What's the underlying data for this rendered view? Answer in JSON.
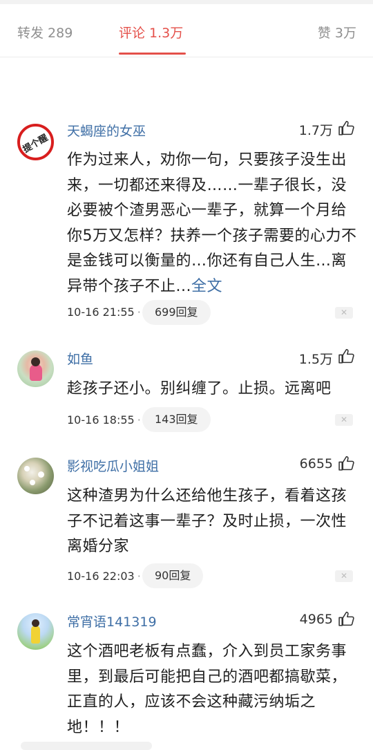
{
  "tabs": [
    {
      "label": "转发 289"
    },
    {
      "label": "评论 1.3万"
    },
    {
      "label": "赞 3万"
    }
  ],
  "comments": [
    {
      "name": "天蝎座的女巫",
      "likes": "1.7万",
      "avatar_text": "提个醒",
      "text": "作为过来人，劝你一句，只要孩子没生出来，一切都还来得及……一辈子很长，没必要被个渣男恶心一辈子，就算一个月给你5万又怎样？扶养一个孩子需要的心力不是金钱可以衡量的…你还有自己人生…离异带个孩子不止...",
      "more": "全文",
      "time": "10-16 21:55",
      "replies": "699回复"
    },
    {
      "name": "如鱼",
      "likes": "1.5万",
      "text": "趁孩子还小。别纠缠了。止损。远离吧",
      "time": "10-16 18:55",
      "replies": "143回复"
    },
    {
      "name": "影视吃瓜小姐姐",
      "likes": "6655",
      "text": "这种渣男为什么还给他生孩子，看着这孩子不记着这事一辈子？及时止损，一次性离婚分家",
      "time": "10-16 22:03",
      "replies": "90回复"
    },
    {
      "name": "常宵语141319",
      "likes": "4965",
      "text": "这个酒吧老板有点蠢，介入到员工家务事里，到最后可能把自己的酒吧都搞歇菜，正直的人，应该不会这种藏污纳垢之地！！！"
    }
  ],
  "colors": {
    "accent": "#e4504a",
    "username": "#3f6fa6"
  },
  "icons": {
    "like": "thumbs-up-icon",
    "close": "close-icon"
  }
}
